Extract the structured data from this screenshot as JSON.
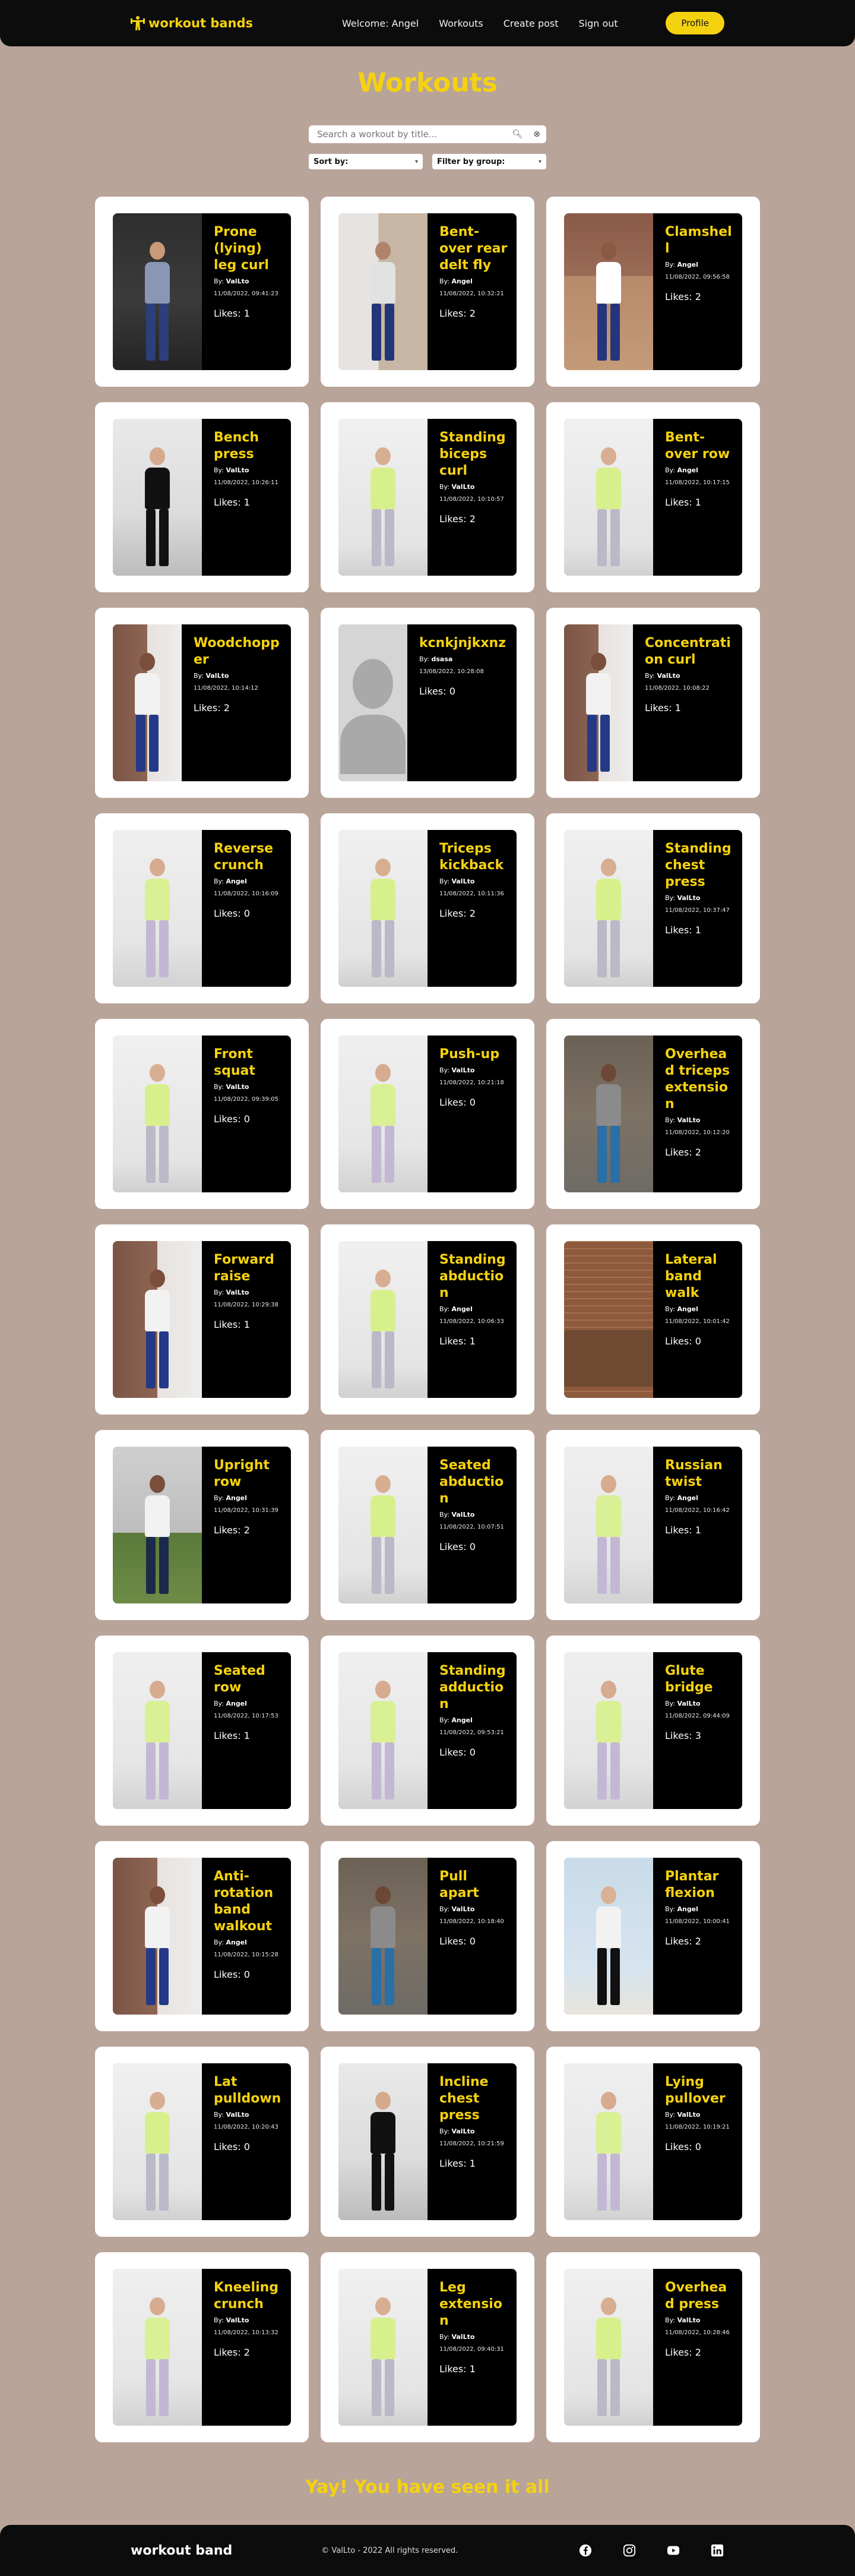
{
  "header": {
    "brand": "workout bands",
    "nav": [
      "Welcome: Angel",
      "Workouts",
      "Create post",
      "Sign out"
    ],
    "profile_label": "Profile"
  },
  "page_title": "Workouts",
  "search": {
    "placeholder": "Search a workout by title..."
  },
  "filters": {
    "sort_label": "Sort by:",
    "group_label": "Filter by group:"
  },
  "colors": {
    "accent": "#f5d20f",
    "background": "#b9a49a",
    "dark": "#0c0c0c"
  },
  "workouts": [
    {
      "title": "Prone (lying) leg curl",
      "author": "ValLto",
      "date": "11/08/2022, 09:41:23",
      "likes": "Likes: 1",
      "scene": "gym"
    },
    {
      "title": "Bent-over rear delt fly",
      "author": "Angel",
      "date": "11/08/2022, 10:32:21",
      "likes": "Likes: 2",
      "scene": "room"
    },
    {
      "title": "Clamshell",
      "author": "Angel",
      "date": "11/08/2022, 09:56:58",
      "likes": "Likes: 2",
      "scene": "wood"
    },
    {
      "title": "Bench press",
      "author": "ValLto",
      "date": "11/08/2022, 10:26:11",
      "likes": "Likes: 1",
      "scene": "bench"
    },
    {
      "title": "Standing biceps curl",
      "author": "ValLto",
      "date": "11/08/2022, 10:10:57",
      "likes": "Likes: 2",
      "scene": "studio"
    },
    {
      "title": "Bent-over row",
      "author": "Angel",
      "date": "11/08/2022, 10:17:15",
      "likes": "Likes: 1",
      "scene": "studio"
    },
    {
      "title": "Woodchopper",
      "author": "ValLto",
      "date": "11/08/2022, 10:14:12",
      "likes": "Likes: 2",
      "scene": "brick"
    },
    {
      "title": "kcnkjnjkxnz",
      "author": "dsasa",
      "date": "13/08/2022, 10:28:08",
      "likes": "Likes: 0",
      "scene": "avatar"
    },
    {
      "title": "Concentration curl",
      "author": "ValLto",
      "date": "11/08/2022, 10:08:22",
      "likes": "Likes: 1",
      "scene": "brick"
    },
    {
      "title": "Reverse crunch",
      "author": "Angel",
      "date": "11/08/2022, 10:16:09",
      "likes": "Likes: 0",
      "scene": "floor"
    },
    {
      "title": "Triceps kickback",
      "author": "ValLto",
      "date": "11/08/2022, 10:11:36",
      "likes": "Likes: 2",
      "scene": "studio"
    },
    {
      "title": "Standing chest press",
      "author": "ValLto",
      "date": "11/08/2022, 10:37:47",
      "likes": "Likes: 1",
      "scene": "studio"
    },
    {
      "title": "Front squat",
      "author": "ValLto",
      "date": "11/08/2022, 09:39:05",
      "likes": "Likes: 0",
      "scene": "studio"
    },
    {
      "title": "Push-up",
      "author": "ValLto",
      "date": "11/08/2022, 10:21:18",
      "likes": "Likes: 0",
      "scene": "floor"
    },
    {
      "title": "Overhead triceps extension",
      "author": "ValLto",
      "date": "11/08/2022, 10:12:20",
      "likes": "Likes: 2",
      "scene": "outdoor"
    },
    {
      "title": "Forward raise",
      "author": "ValLto",
      "date": "11/08/2022, 10:29:38",
      "likes": "Likes: 1",
      "scene": "brick"
    },
    {
      "title": "Standing abduction",
      "author": "Angel",
      "date": "11/08/2022, 10:06:33",
      "likes": "Likes: 1",
      "scene": "studio"
    },
    {
      "title": "Lateral band walk",
      "author": "Angel",
      "date": "11/08/2022, 10:01:42",
      "likes": "Likes: 0",
      "scene": "brickwall"
    },
    {
      "title": "Upright row",
      "author": "Angel",
      "date": "11/08/2022, 10:31:39",
      "likes": "Likes: 2",
      "scene": "city"
    },
    {
      "title": "Seated abduction",
      "author": "ValLto",
      "date": "11/08/2022, 10:07:51",
      "likes": "Likes: 0",
      "scene": "studio"
    },
    {
      "title": "Russian twist",
      "author": "Angel",
      "date": "11/08/2022, 10:16:42",
      "likes": "Likes: 1",
      "scene": "floor"
    },
    {
      "title": "Seated row",
      "author": "Angel",
      "date": "11/08/2022, 10:17:53",
      "likes": "Likes: 1",
      "scene": "floor"
    },
    {
      "title": "Standing adduction",
      "author": "Angel",
      "date": "11/08/2022, 09:53:21",
      "likes": "Likes: 0",
      "scene": "floor"
    },
    {
      "title": "Glute bridge",
      "author": "ValLto",
      "date": "11/08/2022, 09:44:09",
      "likes": "Likes: 3",
      "scene": "floor"
    },
    {
      "title": "Anti-rotation band walkout",
      "author": "Angel",
      "date": "11/08/2022, 10:15:28",
      "likes": "Likes: 0",
      "scene": "brick"
    },
    {
      "title": "Pull apart",
      "author": "ValLto",
      "date": "11/08/2022, 10:18:40",
      "likes": "Likes: 0",
      "scene": "outdoor"
    },
    {
      "title": "Plantar flexion",
      "author": "Angel",
      "date": "11/08/2022, 10:00:41",
      "likes": "Likes: 2",
      "scene": "blue"
    },
    {
      "title": "Lat pulldown",
      "author": "ValLto",
      "date": "11/08/2022, 10:20:43",
      "likes": "Likes: 0",
      "scene": "studio"
    },
    {
      "title": "Incline chest press",
      "author": "ValLto",
      "date": "11/08/2022, 10:21:59",
      "likes": "Likes: 1",
      "scene": "bench"
    },
    {
      "title": "Lying pullover",
      "author": "ValLto",
      "date": "11/08/2022, 10:19:21",
      "likes": "Likes: 0",
      "scene": "floor"
    },
    {
      "title": "Kneeling crunch",
      "author": "ValLto",
      "date": "11/08/2022, 10:13:32",
      "likes": "Likes: 2",
      "scene": "floor"
    },
    {
      "title": "Leg extension",
      "author": "ValLto",
      "date": "11/08/2022, 09:40:31",
      "likes": "Likes: 1",
      "scene": "studio"
    },
    {
      "title": "Overhead press",
      "author": "ValLto",
      "date": "11/08/2022, 10:28:46",
      "likes": "Likes: 2",
      "scene": "studio"
    }
  ],
  "end_message": "Yay! You have seen it all",
  "footer": {
    "brand": "workout band",
    "copyright": "© ValLto - 2022 All rights reserved.",
    "socials": [
      "facebook-icon",
      "instagram-icon",
      "youtube-icon",
      "linkedin-icon"
    ]
  }
}
